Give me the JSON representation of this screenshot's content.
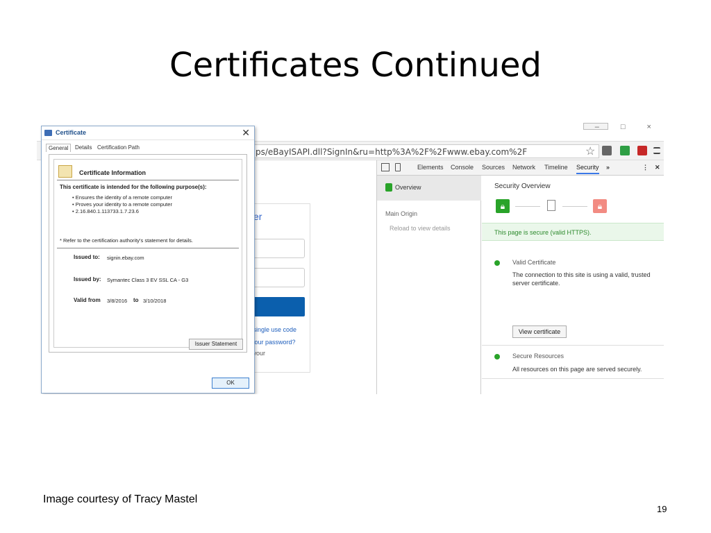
{
  "slide": {
    "title": "Certificates Continued",
    "courtesy": "Image courtesy of Tracy Mastel",
    "page_number": "19"
  },
  "browser": {
    "url": "ps/eBayISAPI.dll?SignIn&ru=http%3A%2F%2Fwww.ebay.com%2F",
    "window_controls": "– □ ×",
    "colors": {
      "pdf_icon": "#c62828",
      "ext_icon_green": "#2e9e44",
      "ext_icon_gray": "#666666"
    }
  },
  "ebay": {
    "heading": "ister",
    "links": [
      "a single use code",
      "t your password?",
      "d your"
    ]
  },
  "devtools": {
    "tabs": [
      "Elements",
      "Console",
      "Sources",
      "Network",
      "Timeline",
      "Security",
      "»"
    ],
    "active_tab": "Security",
    "sidebar": {
      "overview": "Overview",
      "main_origin": "Main Origin",
      "reload_hint": "Reload to view details"
    },
    "main": {
      "title": "Security Overview",
      "secure_message": "This page is secure (valid HTTPS).",
      "valid_cert_title": "Valid Certificate",
      "valid_cert_desc_1": "The connection to this site is using a valid, trusted",
      "valid_cert_desc_2": "server certificate.",
      "view_cert_button": "View certificate",
      "secure_resources_title": "Secure Resources",
      "secure_resources_desc": "All resources on this page are served securely."
    },
    "colors": {
      "secure": "#29a329",
      "insecure": "#f28b82",
      "accent": "#3b78e7"
    }
  },
  "certificate": {
    "window_title": "Certificate",
    "tabs": [
      "General",
      "Details",
      "Certification Path"
    ],
    "active_tab": "General",
    "info_title": "Certificate Information",
    "purpose_heading": "This certificate is intended for the following purpose(s):",
    "purposes": [
      "• Ensures the identity of a remote computer",
      "• Proves your identity to a remote computer",
      "• 2.16.840.1.113733.1.7.23.6"
    ],
    "refer_note": "* Refer to the certification authority's statement for details.",
    "issued_to_label": "Issued to:",
    "issued_to": "signin.ebay.com",
    "issued_by_label": "Issued by:",
    "issued_by": "Symantec Class 3 EV SSL CA - G3",
    "valid_from_label": "Valid from",
    "valid_from": "3/8/2016",
    "valid_to_label": "to",
    "valid_to": "3/10/2018",
    "issuer_statement_button": "Issuer Statement",
    "ok_button": "OK"
  }
}
